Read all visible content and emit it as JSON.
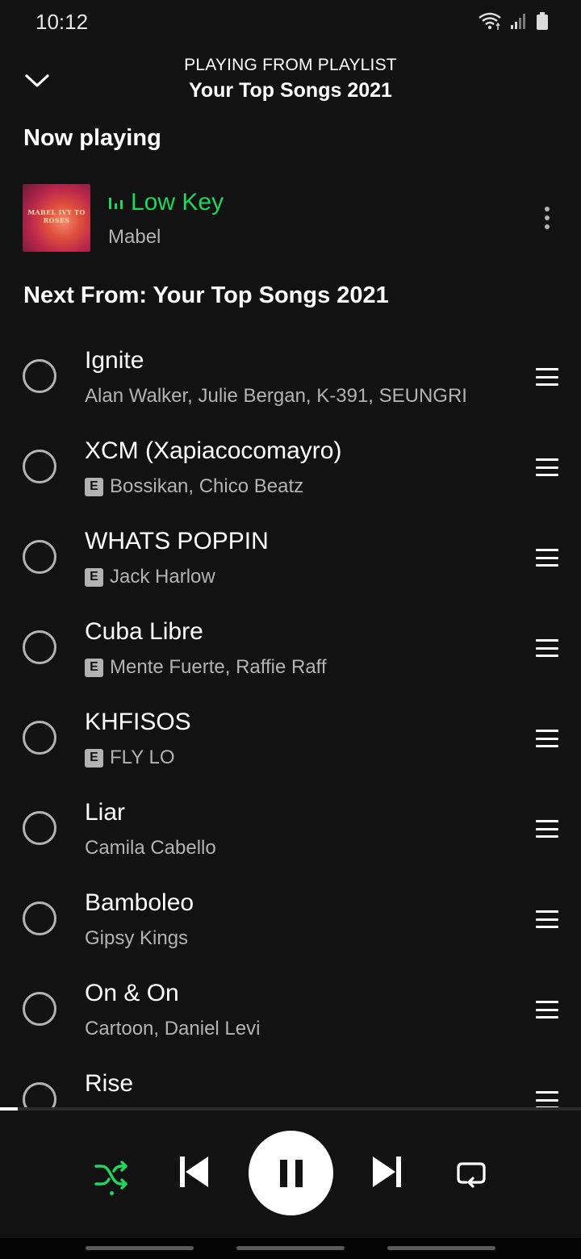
{
  "status_bar": {
    "time": "10:12"
  },
  "header": {
    "context_label": "PLAYING FROM PLAYLIST",
    "playlist_name": "Your Top Songs 2021"
  },
  "now_playing": {
    "section_title": "Now playing",
    "track_title": "Low Key",
    "artist": "Mabel",
    "album_art_text": "MABEL IVY TO ROSES"
  },
  "next_from": {
    "section_title": "Next From: Your Top Songs 2021"
  },
  "queue": [
    {
      "title": "Ignite",
      "artists": "Alan Walker, Julie Bergan, K-391, SEUNGRI",
      "explicit": false
    },
    {
      "title": "XCM (Xapiacocomayro)",
      "artists": "Bossikan, Chico Beatz",
      "explicit": true
    },
    {
      "title": "WHATS POPPIN",
      "artists": "Jack Harlow",
      "explicit": true
    },
    {
      "title": "Cuba Libre",
      "artists": "Mente Fuerte, Raffie Raff",
      "explicit": true
    },
    {
      "title": "KHFISOS",
      "artists": "FLY LO",
      "explicit": true
    },
    {
      "title": "Liar",
      "artists": "Camila Cabello",
      "explicit": false
    },
    {
      "title": "Bamboleo",
      "artists": "Gipsy Kings",
      "explicit": false
    },
    {
      "title": "On & On",
      "artists": "Cartoon, Daniel Levi",
      "explicit": false
    },
    {
      "title": "Rise",
      "artists": "",
      "explicit": false
    }
  ],
  "explicit_badge": "E",
  "player": {
    "progress_fraction": 0.03,
    "shuffle_on": true,
    "state": "playing"
  },
  "colors": {
    "background": "#121212",
    "accent_green": "#1ed760",
    "secondary_text": "#b3b3b3",
    "primary_text": "#ffffff"
  },
  "icons": {
    "collapse": "chevron-down-icon",
    "more": "more-vertical-icon",
    "now_playing_indicator": "equalizer-bars-icon",
    "queue_select": "circle-checkbox-icon",
    "queue_drag": "drag-handle-icon",
    "shuffle": "shuffle-icon",
    "previous": "skip-previous-icon",
    "pause": "pause-icon",
    "next": "skip-next-icon",
    "repeat": "repeat-icon"
  }
}
